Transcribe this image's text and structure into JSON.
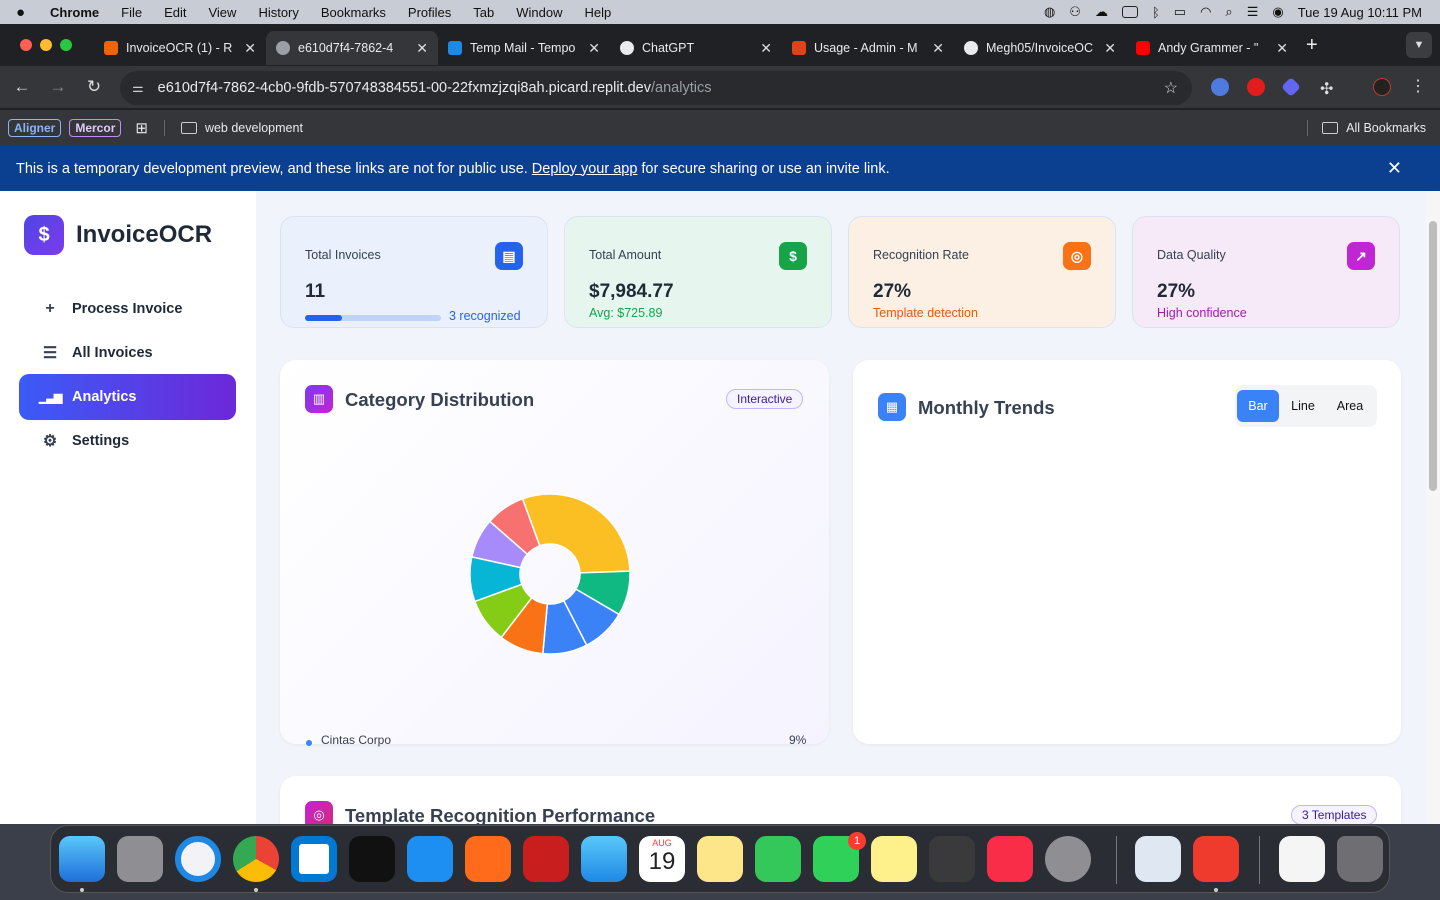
{
  "menubar": {
    "app": "Chrome",
    "items": [
      "File",
      "Edit",
      "View",
      "History",
      "Bookmarks",
      "Profiles",
      "Tab",
      "Window",
      "Help"
    ],
    "datetime": "Tue 19 Aug  10:11 PM"
  },
  "tabs": [
    {
      "title": "InvoiceOCR (1) - R",
      "color": "#f26207"
    },
    {
      "title": "e610d7f4-7862-4",
      "color": "#9aa0a6"
    },
    {
      "title": "Temp Mail - Tempo",
      "color": "#1e88e5"
    },
    {
      "title": "ChatGPT",
      "color": "#e8eaed"
    },
    {
      "title": "Usage - Admin - M",
      "color": "#e0421a"
    },
    {
      "title": "Megh05/InvoiceOC",
      "color": "#e8eaed"
    },
    {
      "title": "Andy Grammer - \"",
      "color": "#ff0000"
    }
  ],
  "omnibox": {
    "host": "e610d7f4-7862-4cb0-9fdb-570748384551-00-22fxmzjzqi8ah.picard.replit.dev",
    "path": "/analytics"
  },
  "bookmarks": {
    "badge1": "Aligner",
    "badge2": "Mercor",
    "folder": "web development",
    "all": "All Bookmarks"
  },
  "banner": {
    "pre": "This is a temporary development preview, and these links are not for public use.",
    "link": "Deploy your app",
    "post": "for secure sharing or use an invite link.",
    "close": "✕"
  },
  "sidebar": {
    "brand": "InvoiceOCR",
    "logo_glyph": "$",
    "items": [
      {
        "label": "Process Invoice",
        "glyph": "+"
      },
      {
        "label": "All Invoices",
        "glyph": "☰"
      },
      {
        "label": "Analytics",
        "glyph": "▁▃▆"
      },
      {
        "label": "Settings",
        "glyph": "⚙"
      }
    ]
  },
  "stats": [
    {
      "label": "Total Invoices",
      "value": "11",
      "sub": "3 recognized",
      "progress": 0.27,
      "bg": "#eaf0fc",
      "icon_bg": "#2563eb",
      "sub_color": "#2563eb",
      "glyph": "▤"
    },
    {
      "label": "Total Amount",
      "value": "$7,984.77",
      "sub": "Avg: $725.89",
      "bg": "#e6f6ee",
      "icon_bg": "#16a34a",
      "sub_color": "#16a34a",
      "glyph": "$"
    },
    {
      "label": "Recognition Rate",
      "value": "27%",
      "sub": "Template detection",
      "bg": "#fcefe4",
      "icon_bg": "#f97316",
      "sub_color": "#ea580c",
      "glyph": "◎"
    },
    {
      "label": "Data Quality",
      "value": "27%",
      "sub": "High confidence",
      "bg": "#f6e9f8",
      "icon_bg": "#c026d3",
      "sub_color": "#a21caf",
      "glyph": "↗"
    }
  ],
  "category": {
    "title": "Category Distribution",
    "badge": "Interactive",
    "legend_label": "Cintas Corpo",
    "legend_value": "9%"
  },
  "chart_data": {
    "type": "pie",
    "title": "Category Distribution",
    "slices": [
      {
        "value": 0.3,
        "color": "#fbbf24"
      },
      {
        "value": 0.09,
        "color": "#10b981"
      },
      {
        "value": 0.09,
        "color": "#3b82f6"
      },
      {
        "value": 0.09,
        "color": "#3b82f6"
      },
      {
        "value": 0.09,
        "color": "#f97316"
      },
      {
        "value": 0.09,
        "color": "#84cc16"
      },
      {
        "value": 0.09,
        "color": "#06b6d4"
      },
      {
        "value": 0.08,
        "color": "#a78bfa"
      },
      {
        "value": 0.08,
        "color": "#f87171"
      }
    ]
  },
  "trends": {
    "title": "Monthly Trends",
    "options": [
      "Bar",
      "Line",
      "Area"
    ],
    "selected": "Bar"
  },
  "template_perf": {
    "title": "Template Recognition Performance",
    "badge": "3 Templates"
  },
  "dock": {
    "calendar_month": "AUG",
    "calendar_day": "19",
    "facetime_badge": "1"
  }
}
